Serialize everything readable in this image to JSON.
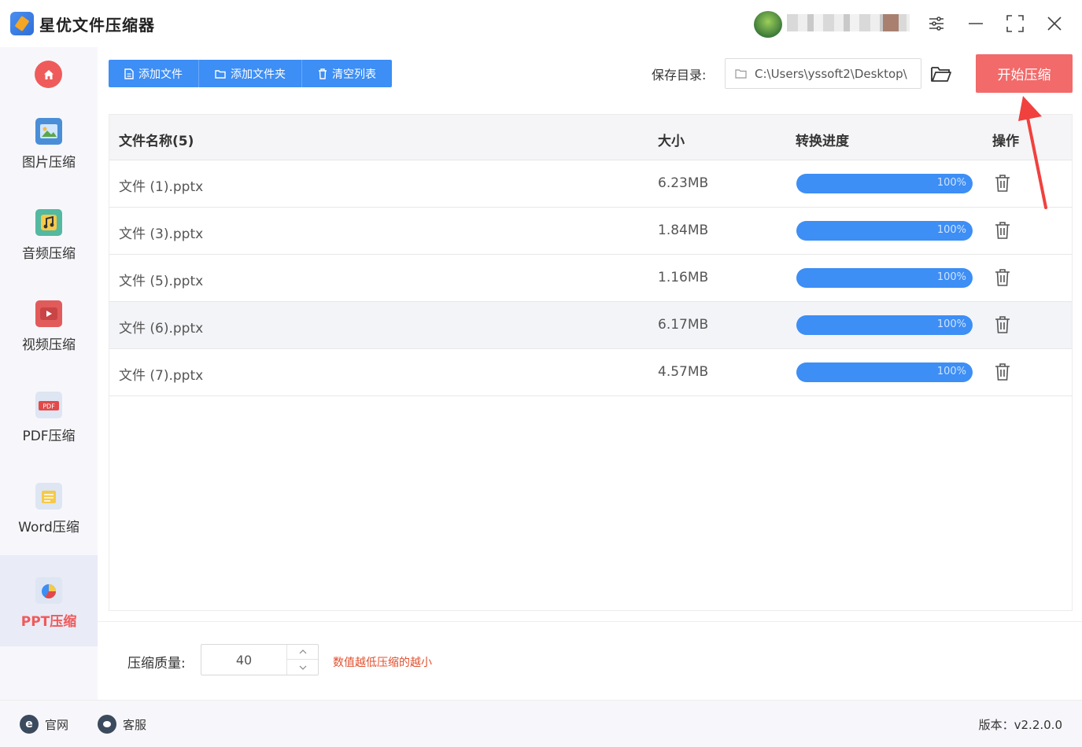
{
  "app": {
    "title": "星优文件压缩器"
  },
  "window_controls": [
    "settings-icon",
    "minimize-icon",
    "maximize-icon",
    "close-icon"
  ],
  "sidebar": {
    "items": [
      {
        "label": "图片压缩",
        "icon": "image-icon"
      },
      {
        "label": "音频压缩",
        "icon": "audio-icon"
      },
      {
        "label": "视频压缩",
        "icon": "video-icon"
      },
      {
        "label": "PDF压缩",
        "icon": "pdf-icon"
      },
      {
        "label": "Word压缩",
        "icon": "word-icon"
      },
      {
        "label": "PPT压缩",
        "icon": "ppt-icon",
        "active": true
      }
    ]
  },
  "toolbar": {
    "add_file": "添加文件",
    "add_folder": "添加文件夹",
    "clear_list": "清空列表",
    "save_label": "保存目录:",
    "save_path": "C:\\Users\\yssoft2\\Desktop\\",
    "start": "开始压缩"
  },
  "table": {
    "headers": {
      "name": "文件名称(5)",
      "size": "大小",
      "progress": "转换进度",
      "action": "操作"
    },
    "rows": [
      {
        "name": "文件 (1).pptx",
        "size": "6.23MB",
        "progress": "100%"
      },
      {
        "name": "文件 (3).pptx",
        "size": "1.84MB",
        "progress": "100%"
      },
      {
        "name": "文件 (5).pptx",
        "size": "1.16MB",
        "progress": "100%"
      },
      {
        "name": "文件 (6).pptx",
        "size": "6.17MB",
        "progress": "100%"
      },
      {
        "name": "文件 (7).pptx",
        "size": "4.57MB",
        "progress": "100%"
      }
    ]
  },
  "settings": {
    "quality_label": "压缩质量:",
    "quality_value": "40",
    "hint": "数值越低压缩的越小"
  },
  "footer": {
    "website": "官网",
    "support": "客服",
    "version": "版本：v2.2.0.0"
  },
  "colors": {
    "primary_blue": "#3d8ef5",
    "start_red": "#f26a6a",
    "active_red": "#f05a5a",
    "hint_orange": "#e0502e"
  }
}
